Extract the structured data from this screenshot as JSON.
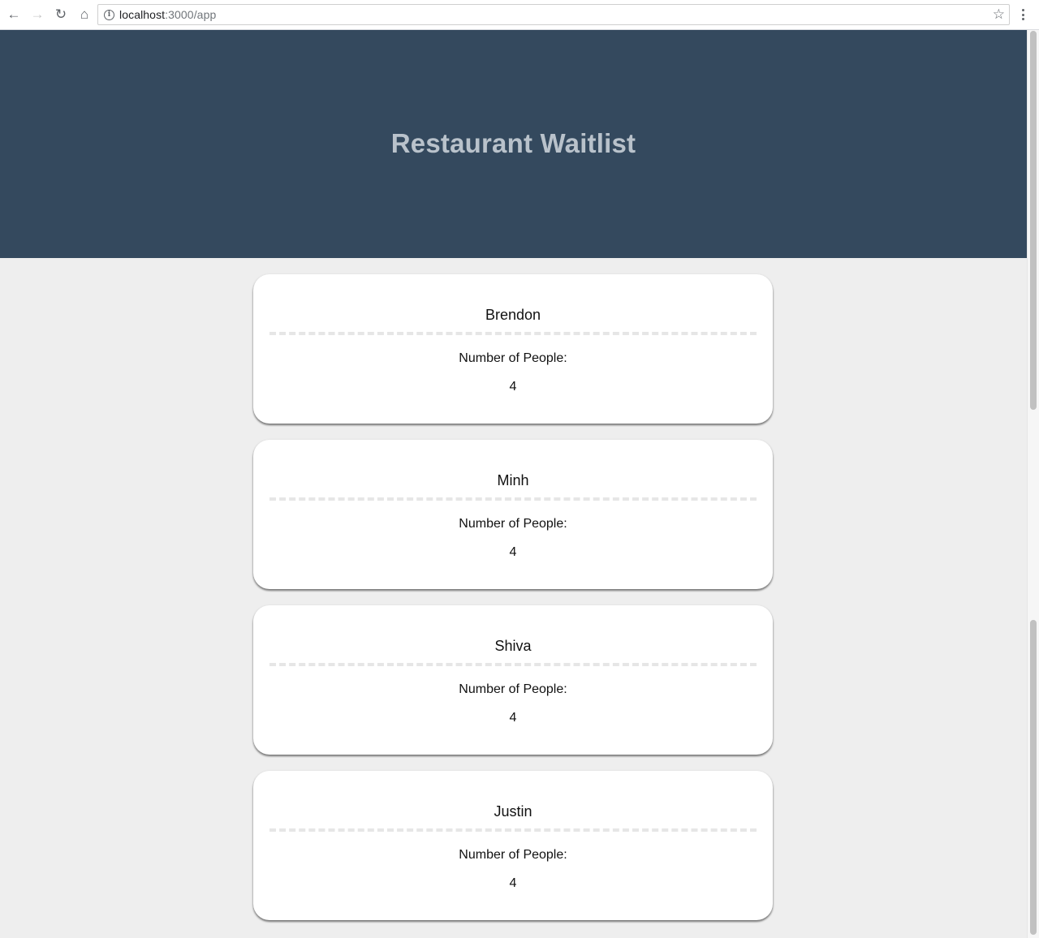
{
  "browser": {
    "back_icon": "←",
    "forward_icon": "→",
    "reload_icon": "↻",
    "home_icon": "⌂",
    "info_icon": "i",
    "url_host": "localhost",
    "url_path": ":3000/app",
    "star_icon": "☆"
  },
  "header": {
    "title": "Restaurant Waitlist",
    "background_color": "#34495e"
  },
  "waitlist": [
    {
      "name": "Brendon",
      "label": "Number of People:",
      "count": "4"
    },
    {
      "name": "Minh",
      "label": "Number of People:",
      "count": "4"
    },
    {
      "name": "Shiva",
      "label": "Number of People:",
      "count": "4"
    },
    {
      "name": "Justin",
      "label": "Number of People:",
      "count": "4"
    }
  ]
}
